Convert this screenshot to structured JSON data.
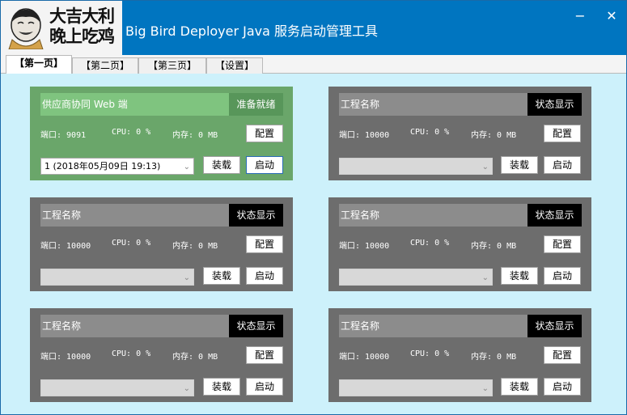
{
  "window": {
    "logo_line1": "大吉大利",
    "logo_line2": "晚上吃鸡",
    "title": "Big Bird Deployer Java 服务启动管理工具",
    "minimize_symbol": "−",
    "close_symbol": "✕"
  },
  "tabs": [
    {
      "label": "【第一页】",
      "active": true
    },
    {
      "label": "【第二页】",
      "active": false
    },
    {
      "label": "【第三页】",
      "active": false
    },
    {
      "label": "【设置】",
      "active": false
    }
  ],
  "cards": [
    {
      "name": "供应商协同 Web 端",
      "status": "准备就绪",
      "port": "端口: 9091",
      "cpu": "CPU: 0 %",
      "mem": "内存: 0 MB",
      "config_label": "配置",
      "version": "1 (2018年05月09日 19:13)",
      "load_label": "装载",
      "start_label": "启动",
      "state": "ready"
    },
    {
      "name": "工程名称",
      "status": "状态显示",
      "port": "端口: 10000",
      "cpu": "CPU: 0 %",
      "mem": "内存: 0 MB",
      "config_label": "配置",
      "version": "",
      "load_label": "装载",
      "start_label": "启动",
      "state": "idle"
    },
    {
      "name": "工程名称",
      "status": "状态显示",
      "port": "端口: 10000",
      "cpu": "CPU: 0 %",
      "mem": "内存: 0 MB",
      "config_label": "配置",
      "version": "",
      "load_label": "装载",
      "start_label": "启动",
      "state": "idle"
    },
    {
      "name": "工程名称",
      "status": "状态显示",
      "port": "端口: 10000",
      "cpu": "CPU: 0 %",
      "mem": "内存: 0 MB",
      "config_label": "配置",
      "version": "",
      "load_label": "装载",
      "start_label": "启动",
      "state": "idle"
    },
    {
      "name": "工程名称",
      "status": "状态显示",
      "port": "端口: 10000",
      "cpu": "CPU: 0 %",
      "mem": "内存: 0 MB",
      "config_label": "配置",
      "version": "",
      "load_label": "装载",
      "start_label": "启动",
      "state": "idle"
    },
    {
      "name": "工程名称",
      "status": "状态显示",
      "port": "端口: 10000",
      "cpu": "CPU: 0 %",
      "mem": "内存: 0 MB",
      "config_label": "配置",
      "version": "",
      "load_label": "装载",
      "start_label": "启动",
      "state": "idle"
    }
  ],
  "colors": {
    "titlebar": "#0075c0",
    "content_bg": "#cdf1fb",
    "card_idle": "#6d6d6d",
    "card_ready": "#6aa66a",
    "status_idle": "#000000",
    "status_ready": "#58965a"
  },
  "icons": {
    "logo": "meme-face-icon",
    "dropdown": "chevron-down-icon"
  }
}
